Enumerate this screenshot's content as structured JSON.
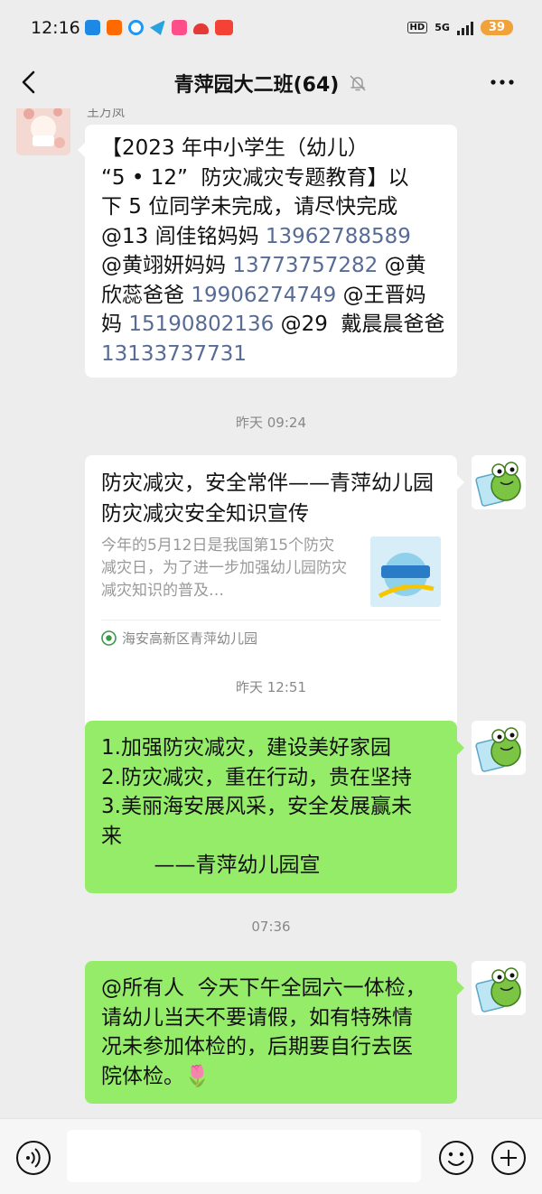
{
  "status": {
    "time": "12:16",
    "hd": "HD",
    "network": "5G",
    "battery": "39"
  },
  "header": {
    "title": "青萍园大二班(64)"
  },
  "messages": {
    "m1": {
      "sender": "王万凤",
      "lines": [
        [
          {
            "t": "【2023 年中小学生（幼儿）"
          }
        ],
        [
          {
            "t": "“5 • 12”  防灾减灾专题教育】以"
          }
        ],
        [
          {
            "t": "下 5 位同学未完成，请尽快完成"
          }
        ],
        [
          {
            "t": "@13 闾佳铭妈妈 "
          },
          {
            "t": "13962788589",
            "link": true
          }
        ],
        [
          {
            "t": "@黄翊妍妈妈 "
          },
          {
            "t": "13773757282",
            "link": true
          },
          {
            "t": " @黄"
          }
        ],
        [
          {
            "t": "欣蕊爸爸 "
          },
          {
            "t": "19906274749",
            "link": true
          },
          {
            "t": " @王晋妈"
          }
        ],
        [
          {
            "t": "妈 "
          },
          {
            "t": "15190802136",
            "link": true
          },
          {
            "t": " @29  戴晨晨爸爸"
          }
        ],
        [
          {
            "t": "13133737731",
            "link": true
          }
        ]
      ]
    },
    "ts1": "昨天 09:24",
    "card": {
      "title": "防灾减灾，安全常伴——青萍幼儿园防灾减灾安全知识宣传",
      "desc": "今年的5月12日是我国第15个防灾减灾日，为了进一步加强幼儿园防灾减灾知识的普及…",
      "source": "海安高新区青萍幼儿园"
    },
    "ts2": "昨天 12:51",
    "m3": {
      "lines": [
        "1.加强防灾减灾，建设美好家园",
        "2.防灾减灾，重在行动，贵在坚持",
        "3.美丽海安展风采，安全发展赢未",
        "来",
        "        ——青萍幼儿园宣"
      ]
    },
    "ts3": "07:36",
    "m4": {
      "lines": [
        "@所有人  今天下午全园六一体检，",
        "请幼儿当天不要请假，如有特殊情",
        "况未参加体检的，后期要自行去医",
        "院体检。🌷"
      ]
    }
  },
  "colors": {
    "bubble_green": "#95ec69",
    "link": "#576b95",
    "background": "#ededed"
  }
}
